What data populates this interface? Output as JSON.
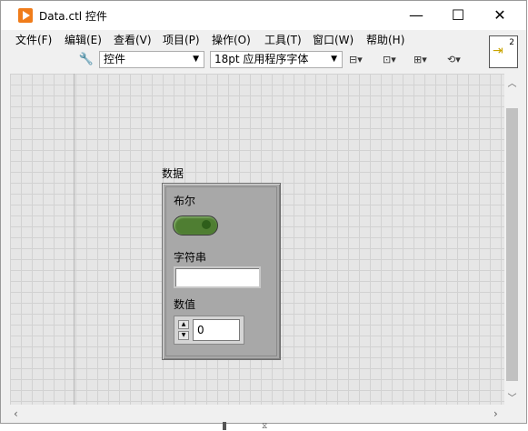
{
  "window": {
    "title": "Data.ctl 控件",
    "minimize": "—",
    "maximize": "☐",
    "close": "✕"
  },
  "menu": [
    "文件(F)",
    "编辑(E)",
    "查看(V)",
    "项目(P)",
    "操作(O)",
    "工具(T)",
    "窗口(W)",
    "帮助(H)"
  ],
  "toolbar": {
    "control_type": "控件",
    "font": "18pt 应用程序字体"
  },
  "connector_pane": {
    "count": "2"
  },
  "cluster": {
    "label": "数据",
    "boolean_label": "布尔",
    "string_label": "字符串",
    "string_value": "",
    "numeric_label": "数值",
    "numeric_value": "0"
  }
}
